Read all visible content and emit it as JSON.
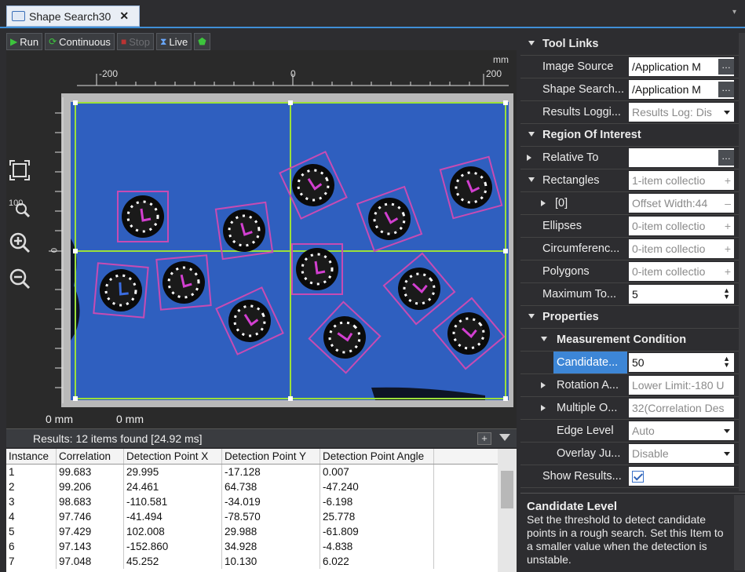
{
  "tab": {
    "title": "Shape Search30",
    "close": "✕"
  },
  "toolbar": {
    "run": "Run",
    "continuous": "Continuous",
    "stop": "Stop",
    "live": "Live"
  },
  "view": {
    "ruler_unit_top": "mm",
    "ruler_top_labels": [
      "-200",
      "0",
      "200"
    ],
    "ruler_left_label": "0",
    "origin_x_label": "0 mm",
    "origin_y_label": "0 mm"
  },
  "results": {
    "summary": "Results: 12 items found [24.92 ms]",
    "plus": "+",
    "columns": [
      "Instance",
      "Correlation",
      "Detection Point X",
      "Detection Point Y",
      "Detection Point Angle",
      ""
    ],
    "rows": [
      [
        "1",
        "99.683",
        "29.995",
        "-17.128",
        "0.007",
        ""
      ],
      [
        "2",
        "99.206",
        "24.461",
        "64.738",
        "-47.240",
        ""
      ],
      [
        "3",
        "98.683",
        "-110.581",
        "-34.019",
        "-6.198",
        ""
      ],
      [
        "4",
        "97.746",
        "-41.494",
        "-78.570",
        "25.778",
        ""
      ],
      [
        "5",
        "97.429",
        "102.008",
        "29.988",
        "-61.809",
        ""
      ],
      [
        "6",
        "97.143",
        "-152.860",
        "34.928",
        "-4.838",
        ""
      ],
      [
        "7",
        "97.048",
        "45.252",
        "10.130",
        "6.022",
        ""
      ]
    ]
  },
  "properties": {
    "tool_links": "Tool Links",
    "image_source_label": "Image Source",
    "image_source_value": "/Application M",
    "shape_search_label": "Shape Search...",
    "shape_search_value": "/Application M",
    "results_logging_label": "Results Loggi...",
    "results_logging_value": "Results Log: Dis",
    "roi": "Region Of Interest",
    "relative_to_label": "Relative To",
    "relative_to_value": "",
    "rectangles_label": "Rectangles",
    "rectangles_value": "1-item collectio",
    "rect0_label": "[0]",
    "rect0_value": "Offset Width:44",
    "ellipses_label": "Ellipses",
    "ellipses_value": "0-item collectio",
    "circumference_label": "Circumferenc...",
    "circumference_value": "0-item collectio",
    "polygons_label": "Polygons",
    "polygons_value": "0-item collectio",
    "maximum_label": "Maximum To...",
    "maximum_value": "5",
    "properties": "Properties",
    "measurement": "Measurement Condition",
    "candidate_label": "Candidate...",
    "candidate_value": "50",
    "rotation_label": "Rotation A...",
    "rotation_value": "Lower Limit:-180 U",
    "multiple_label": "Multiple O...",
    "multiple_value": "32(Correlation Des",
    "edge_label": "Edge Level",
    "edge_value": "Auto",
    "overlay_label": "Overlay Ju...",
    "overlay_value": "Disable",
    "show_results_label": "Show Results..."
  },
  "help": {
    "title": "Candidate Level",
    "text": "Set the threshold to detect candidate points in a rough search. Set this Item to a smaller value when the detection is unstable."
  }
}
